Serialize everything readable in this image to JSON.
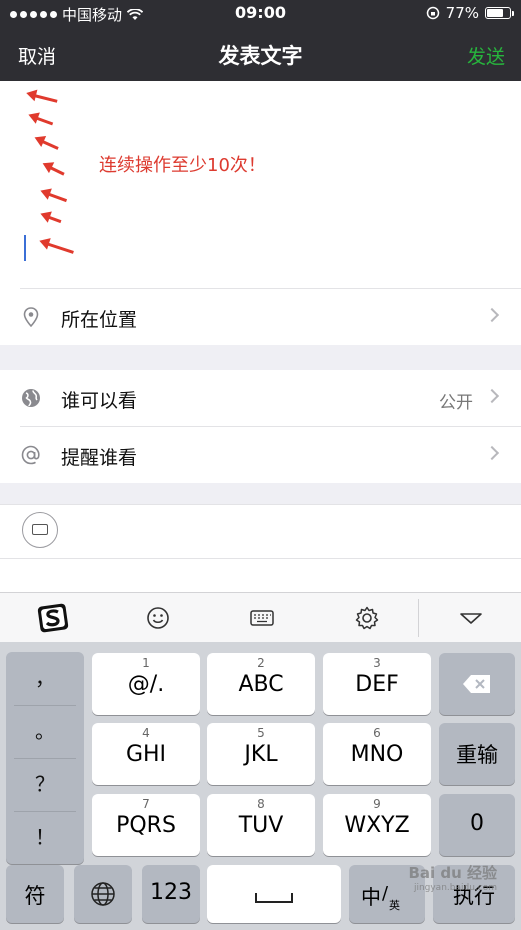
{
  "status_bar": {
    "carrier": "中国移动",
    "time": "09:00",
    "battery": "77%",
    "battery_level": 0.77
  },
  "nav": {
    "cancel": "取消",
    "title": "发表文字",
    "send": "发送"
  },
  "compose": {
    "annotation": "连续操作至少10次！"
  },
  "rows": {
    "location": {
      "label": "所在位置"
    },
    "visibility": {
      "label": "谁可以看",
      "value": "公开"
    },
    "mention": {
      "label": "提醒谁看"
    }
  },
  "keyboard": {
    "symbols": [
      "，",
      "。",
      "？",
      "！"
    ],
    "keys": [
      {
        "num": "1",
        "label": "@/."
      },
      {
        "num": "2",
        "label": "ABC"
      },
      {
        "num": "3",
        "label": "DEF"
      },
      {
        "num": "4",
        "label": "GHI"
      },
      {
        "num": "5",
        "label": "JKL"
      },
      {
        "num": "6",
        "label": "MNO"
      },
      {
        "num": "7",
        "label": "PQRS"
      },
      {
        "num": "8",
        "label": "TUV"
      },
      {
        "num": "9",
        "label": "WXYZ"
      }
    ],
    "retype": "重输",
    "zero": "0",
    "symbol_key": "符",
    "numeric_key": "123",
    "lang_key": "中",
    "lang_sub": "英",
    "enter_key": "执行"
  },
  "watermark": {
    "brand": "Bai du 经验",
    "url": "jingyan.baidu.com"
  },
  "colors": {
    "nav_bg": "#2e2e33",
    "send_green": "#27b53d",
    "annotation_red": "#dd3b30",
    "keyboard_bg": "#d1d4d9"
  }
}
